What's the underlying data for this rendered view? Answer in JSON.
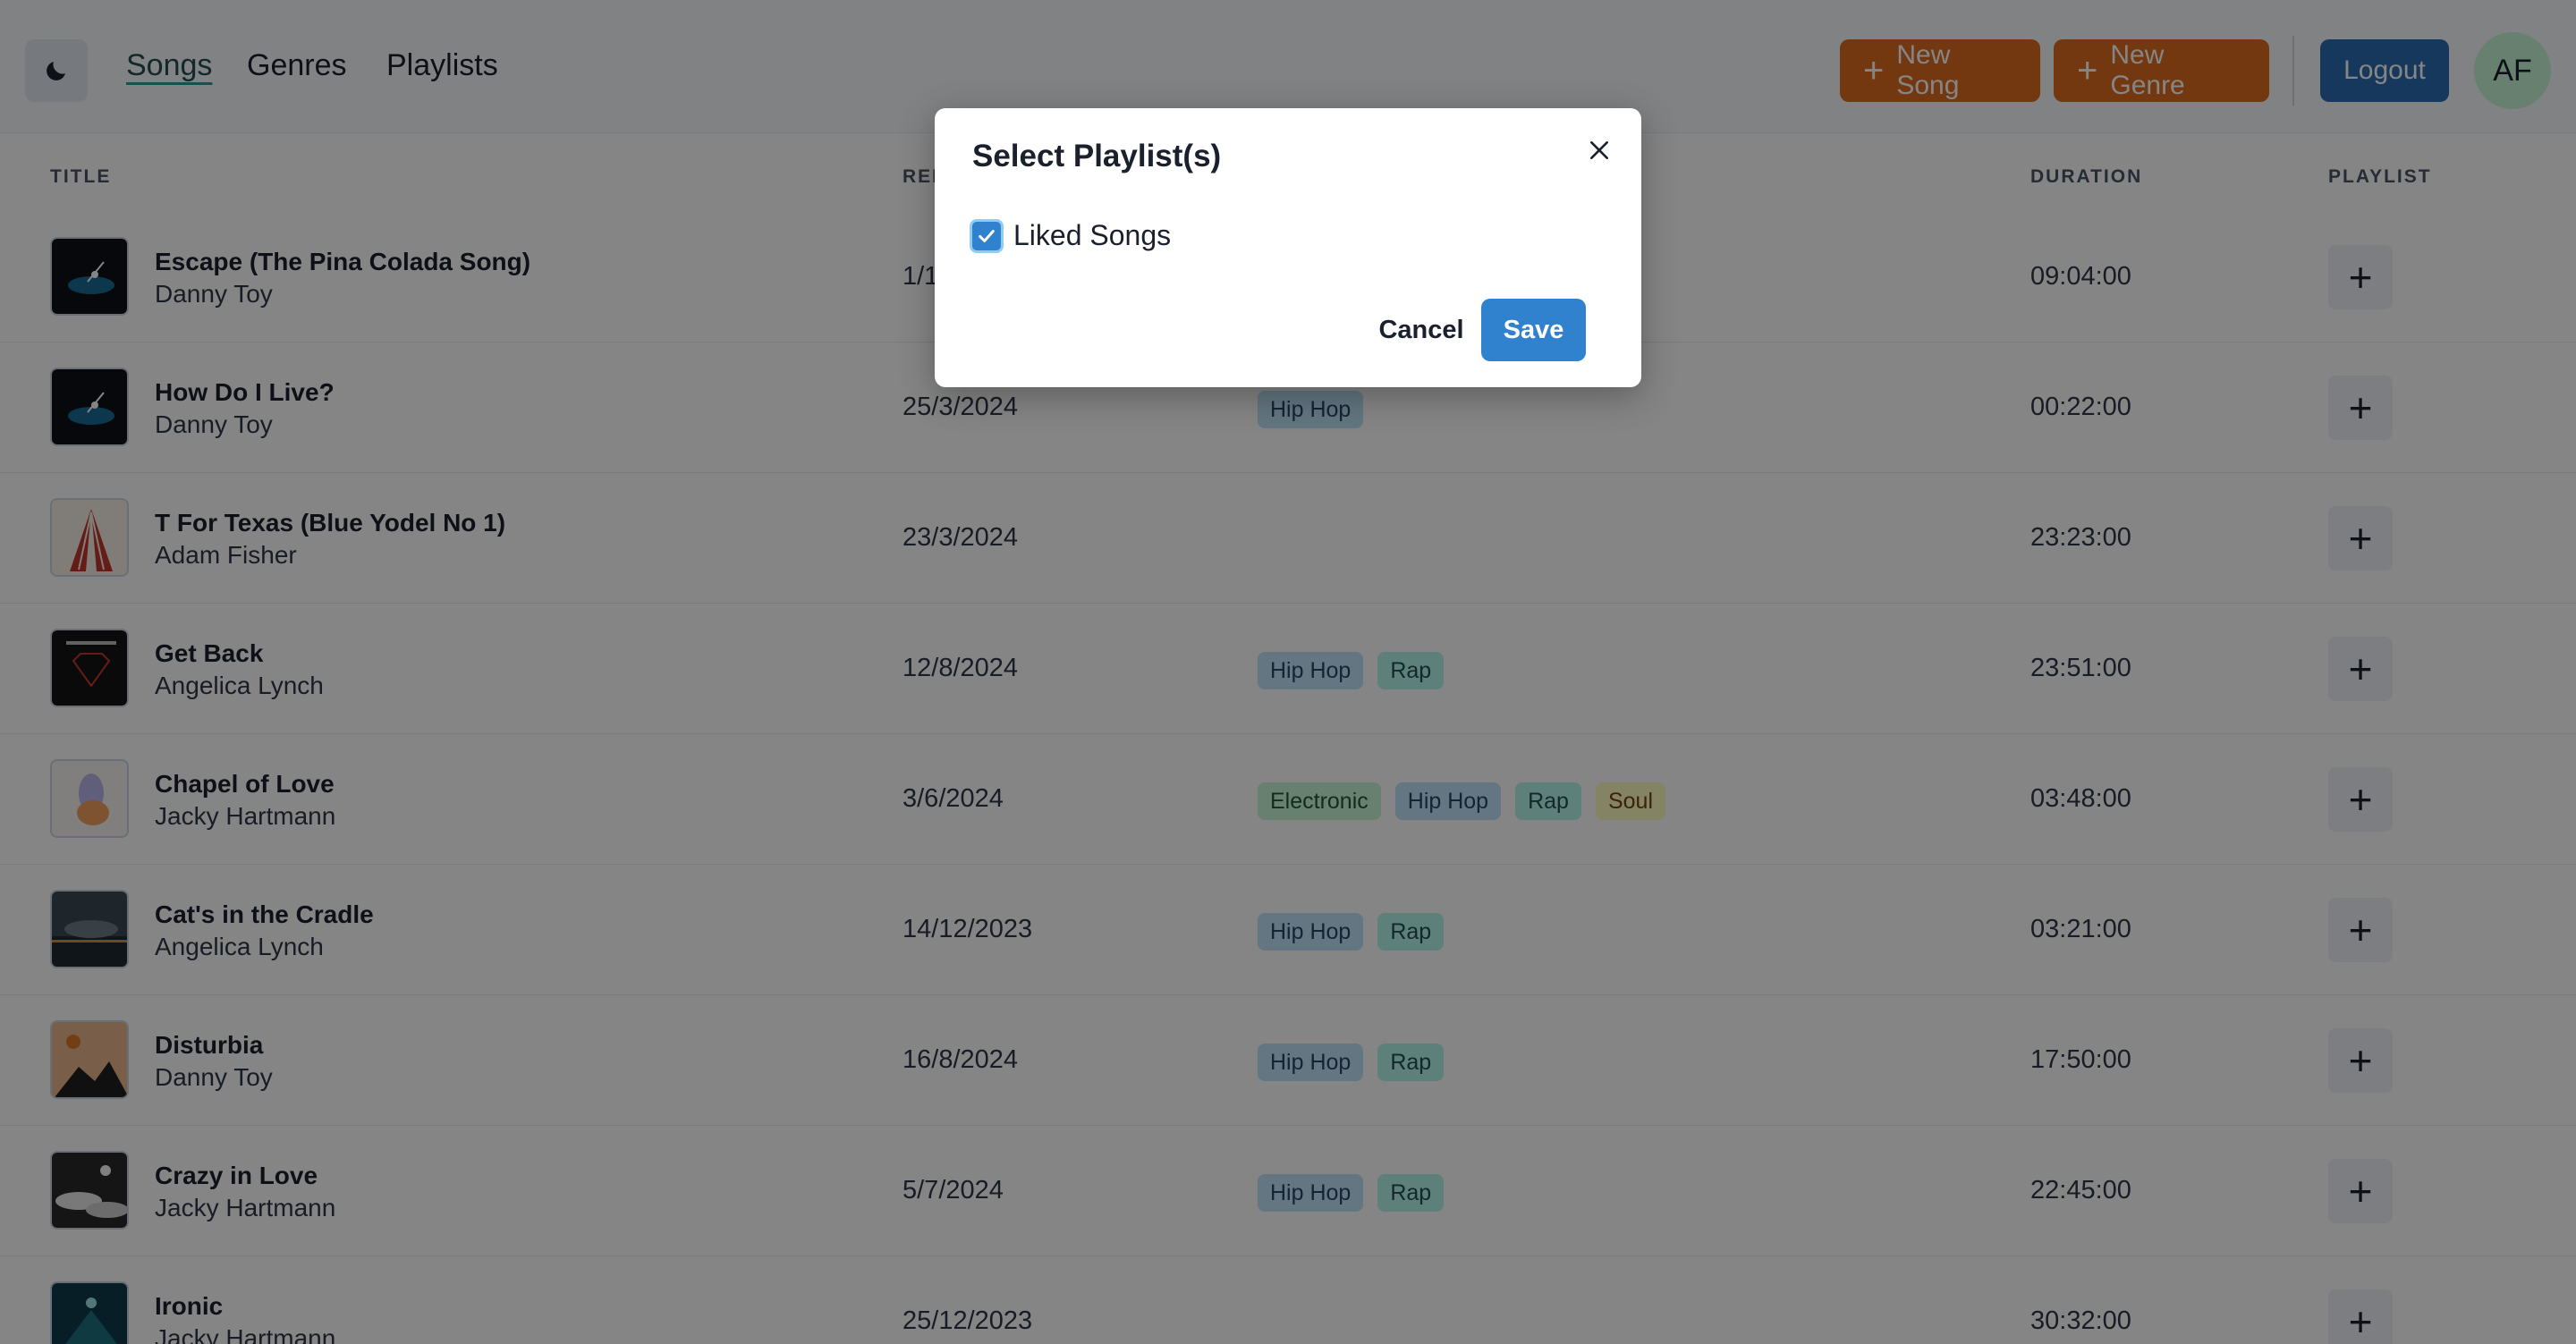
{
  "nav": {
    "links": [
      "Songs",
      "Genres",
      "Playlists"
    ],
    "active": "Songs"
  },
  "header": {
    "new_song_label": "New Song",
    "new_genre_label": "New Genre",
    "logout_label": "Logout",
    "avatar_initials": "AF"
  },
  "table": {
    "columns": {
      "title": "TITLE",
      "release": "REL",
      "duration": "DURATION",
      "playlist": "PLAYLIST"
    },
    "rows": [
      {
        "title": "Escape (The Pina Colada Song)",
        "artist": "Danny Toy",
        "date": "1/1",
        "genres": [],
        "duration": "09:04:00",
        "art": "dark-turntable"
      },
      {
        "title": "How Do I Live?",
        "artist": "Danny Toy",
        "date": "25/3/2024",
        "genres": [
          "Hip Hop"
        ],
        "duration": "00:22:00",
        "art": "dark-turntable"
      },
      {
        "title": "T For Texas (Blue Yodel No 1)",
        "artist": "Adam Fisher",
        "date": "23/3/2024",
        "genres": [],
        "duration": "23:23:00",
        "art": "red-wings"
      },
      {
        "title": "Get Back",
        "artist": "Angelica Lynch",
        "date": "12/8/2024",
        "genres": [
          "Hip Hop",
          "Rap"
        ],
        "duration": "23:51:00",
        "art": "diamond"
      },
      {
        "title": "Chapel of Love",
        "artist": "Jacky Hartmann",
        "date": "3/6/2024",
        "genres": [
          "Electronic",
          "Hip Hop",
          "Rap",
          "Soul"
        ],
        "duration": "03:48:00",
        "art": "pastel-figure"
      },
      {
        "title": "Cat's in the Cradle",
        "artist": "Angelica Lynch",
        "date": "14/12/2023",
        "genres": [
          "Hip Hop",
          "Rap"
        ],
        "duration": "03:21:00",
        "art": "storm-sky"
      },
      {
        "title": "Disturbia",
        "artist": "Danny Toy",
        "date": "16/8/2024",
        "genres": [
          "Hip Hop",
          "Rap"
        ],
        "duration": "17:50:00",
        "art": "mountain-sunset"
      },
      {
        "title": "Crazy in Love",
        "artist": "Jacky Hartmann",
        "date": "5/7/2024",
        "genres": [
          "Hip Hop",
          "Rap"
        ],
        "duration": "22:45:00",
        "art": "clouds-moon"
      },
      {
        "title": "Ironic",
        "artist": "Jacky Hartmann",
        "date": "25/12/2023",
        "genres": [],
        "duration": "30:32:00",
        "art": "teal-mountain"
      }
    ]
  },
  "genre_colors": {
    "Hip Hop": "blue",
    "Rap": "teal",
    "Electronic": "green",
    "Soul": "yellow"
  },
  "modal": {
    "title": "Select Playlist(s)",
    "options": [
      {
        "label": "Liked Songs",
        "checked": true
      }
    ],
    "cancel_label": "Cancel",
    "save_label": "Save"
  }
}
